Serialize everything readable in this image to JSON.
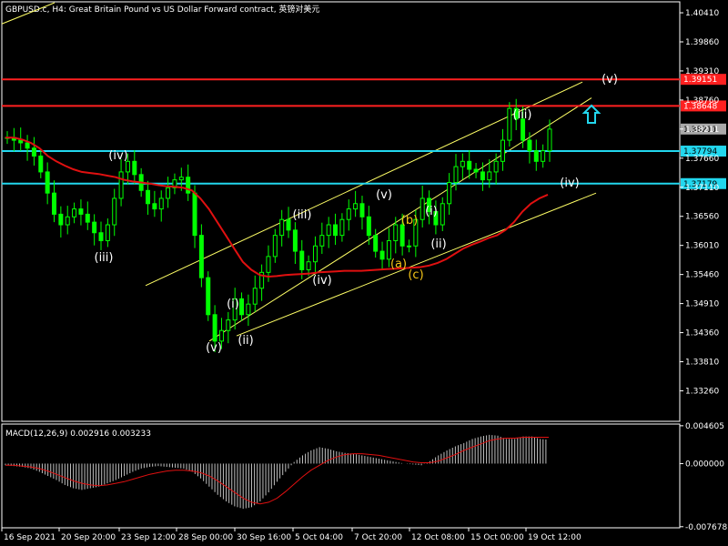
{
  "header": {
    "symbol_line": "GBPUSD.c, H4:  Great Britain Pound vs US Dollar Forward contract, 英镑对美元"
  },
  "macd_label": "MACD(12,26,9) 0.002916 0.003233",
  "colors": {
    "background": "#000000",
    "candle": "#00ff00",
    "ma": "#e01010",
    "channel": "#ffff66",
    "resistance": "#ff2020",
    "support": "#22d7ee",
    "arrow": "#22d7ee",
    "macd_hist": "#c0c0c0",
    "macd_signal": "#e01010"
  },
  "chart_data": {
    "type": "candlestick",
    "symbol": "GBPUSD.c",
    "timeframe": "H4",
    "ylim": [
      1.327,
      1.406
    ],
    "price_ticks": [
      "1.40410",
      "1.39860",
      "1.39310",
      "1.38760",
      "1.38211",
      "1.37660",
      "1.37110",
      "1.36560",
      "1.36010",
      "1.35460",
      "1.34910",
      "1.34360",
      "1.33810",
      "1.33260"
    ],
    "x_ticks": [
      "16 Sep 2021",
      "20 Sep 20:00",
      "23 Sep 12:00",
      "28 Sep 00:00",
      "30 Sep 16:00",
      "5 Oct 04:00",
      "7 Oct 20:00",
      "12 Oct 08:00",
      "15 Oct 00:00",
      "19 Oct 12:00"
    ],
    "current_price": "1.38211",
    "price_path": [
      1.3805,
      1.38,
      1.3795,
      1.3785,
      1.377,
      1.374,
      1.37,
      1.366,
      1.364,
      1.3655,
      1.367,
      1.366,
      1.3645,
      1.3625,
      1.361,
      1.364,
      1.369,
      1.374,
      1.376,
      1.3735,
      1.3705,
      1.368,
      1.367,
      1.369,
      1.371,
      1.3725,
      1.373,
      1.37,
      1.362,
      1.354,
      1.347,
      1.342,
      1.344,
      1.346,
      1.35,
      1.347,
      1.349,
      1.352,
      1.355,
      1.358,
      1.362,
      1.365,
      1.363,
      1.359,
      1.3555,
      1.357,
      1.36,
      1.362,
      1.364,
      1.362,
      1.365,
      1.367,
      1.368,
      1.3655,
      1.362,
      1.359,
      1.3575,
      1.361,
      1.364,
      1.36,
      1.36,
      1.365,
      1.369,
      1.3665,
      1.364,
      1.368,
      1.372,
      1.375,
      1.376,
      1.3745,
      1.374,
      1.3725,
      1.374,
      1.376,
      1.38,
      1.386,
      1.384,
      1.38,
      1.378,
      1.376,
      1.378,
      1.3821
    ],
    "moving_average": [
      1.3805,
      1.3805,
      1.3801,
      1.3795,
      1.3785,
      1.377,
      1.376,
      1.3752,
      1.3745,
      1.374,
      1.3738,
      1.3736,
      1.3733,
      1.373,
      1.3725,
      1.3722,
      1.372,
      1.3718,
      1.3715,
      1.3713,
      1.3712,
      1.371,
      1.3705,
      1.369,
      1.367,
      1.3645,
      1.362,
      1.3595,
      1.357,
      1.3555,
      1.3545,
      1.3542,
      1.3543,
      1.3545,
      1.3546,
      1.3547,
      1.3548,
      1.355,
      1.3551,
      1.3552,
      1.3553,
      1.3553,
      1.3553,
      1.3554,
      1.3555,
      1.3556,
      1.3557,
      1.3558,
      1.3559,
      1.356,
      1.3563,
      1.3568,
      1.3575,
      1.3585,
      1.3595,
      1.3602,
      1.3608,
      1.3615,
      1.362,
      1.363,
      1.3645,
      1.3665,
      1.368,
      1.369,
      1.3697
    ],
    "horizontal_levels": [
      {
        "label": "1.39151",
        "value": 1.39151,
        "kind": "resistance"
      },
      {
        "label": "1.38648",
        "value": 1.38648,
        "kind": "resistance"
      },
      {
        "label": "1.37794",
        "value": 1.37794,
        "kind": "support"
      },
      {
        "label": "1.37179",
        "value": 1.37179,
        "kind": "support"
      }
    ],
    "wave_labels": [
      {
        "text": "(iv)",
        "color": "white"
      },
      {
        "text": "(iii)",
        "color": "white"
      },
      {
        "text": "(iii)",
        "color": "white"
      },
      {
        "text": "(v)",
        "color": "white"
      },
      {
        "text": "(i)",
        "color": "white"
      },
      {
        "text": "(v)",
        "color": "white"
      },
      {
        "text": "(ii)",
        "color": "white"
      },
      {
        "text": "(iv)",
        "color": "white"
      },
      {
        "text": "(b)",
        "color": "gold"
      },
      {
        "text": "(a)",
        "color": "gold"
      },
      {
        "text": "(c)",
        "color": "gold"
      },
      {
        "text": "(i)",
        "color": "white"
      },
      {
        "text": "(ii)",
        "color": "white"
      },
      {
        "text": "(iii)",
        "color": "white"
      },
      {
        "text": "(iv)",
        "color": "white"
      },
      {
        "text": "(v)",
        "color": "white"
      }
    ],
    "macd": {
      "ticks": [
        "0.004605",
        "0.000000",
        "-0.007678"
      ],
      "ylim": [
        -0.0077,
        0.0047
      ],
      "histogram": [
        -0.0002,
        -0.0003,
        -0.0004,
        -0.0006,
        -0.001,
        -0.0015,
        -0.002,
        -0.0026,
        -0.003,
        -0.0032,
        -0.003,
        -0.0028,
        -0.0024,
        -0.002,
        -0.0015,
        -0.001,
        -0.0006,
        -0.0004,
        -0.0003,
        -0.0004,
        -0.0005,
        -0.0006,
        -0.001,
        -0.0018,
        -0.0028,
        -0.0038,
        -0.0046,
        -0.0052,
        -0.0055,
        -0.0053,
        -0.0046,
        -0.0035,
        -0.0022,
        -0.001,
        0.0002,
        0.001,
        0.0016,
        0.002,
        0.0018,
        0.0015,
        0.0013,
        0.0012,
        0.001,
        0.0008,
        0.0006,
        0.0004,
        0.0002,
        0.0,
        -0.0001,
        -0.0002,
        0.0003,
        0.001,
        0.0016,
        0.0021,
        0.0025,
        0.003,
        0.0033,
        0.0035,
        0.0034,
        0.003,
        0.003,
        0.0033,
        0.0033,
        0.003,
        0.0029
      ],
      "signal": [
        -0.0002,
        -0.0002,
        -0.0003,
        -0.0004,
        -0.0006,
        -0.0009,
        -0.0013,
        -0.0017,
        -0.0021,
        -0.0024,
        -0.0026,
        -0.0027,
        -0.0026,
        -0.0024,
        -0.0022,
        -0.0019,
        -0.0016,
        -0.0013,
        -0.0011,
        -0.0009,
        -0.0008,
        -0.0008,
        -0.0009,
        -0.0011,
        -0.0015,
        -0.0021,
        -0.0028,
        -0.0035,
        -0.0042,
        -0.0047,
        -0.0049,
        -0.0047,
        -0.0042,
        -0.0034,
        -0.0025,
        -0.0016,
        -0.0008,
        -0.0002,
        0.0004,
        0.0008,
        0.0011,
        0.0012,
        0.0012,
        0.0011,
        0.001,
        0.0008,
        0.0006,
        0.0004,
        0.0002,
        0.0001,
        0.0001,
        0.0003,
        0.0007,
        0.0011,
        0.0016,
        0.002,
        0.0024,
        0.0028,
        0.003,
        0.0031,
        0.0031,
        0.0032,
        0.0032,
        0.0032,
        0.0032
      ]
    }
  }
}
